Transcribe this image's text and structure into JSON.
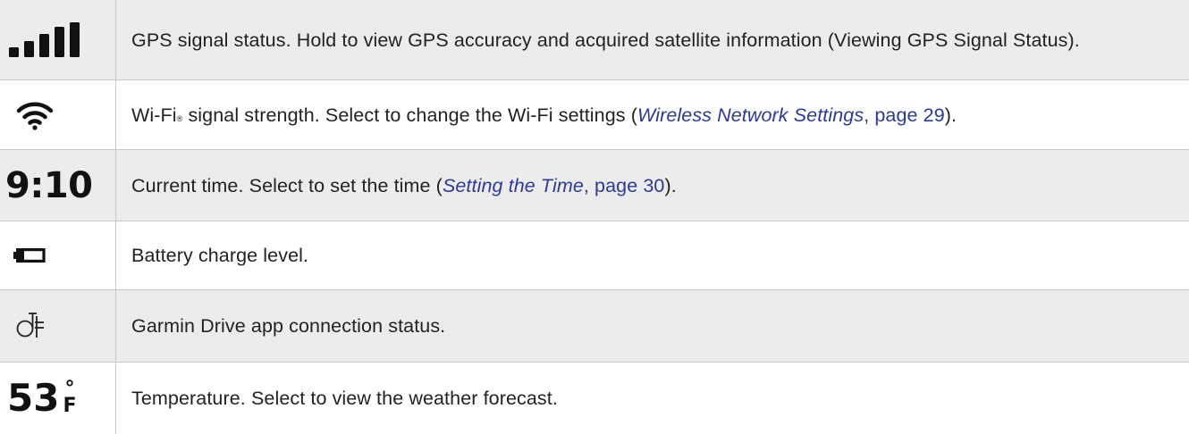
{
  "rows": [
    {
      "icon": "gps-signal-bars-icon",
      "text": "GPS signal status. Hold to view GPS accuracy and acquired satellite information (Viewing GPS Signal Status)."
    },
    {
      "icon": "wifi-icon",
      "text_before": "Wi-Fi",
      "registered": "®",
      "text_middle": " signal strength. Select to change the Wi-Fi settings (",
      "link_title": "Wireless Network Settings",
      "link_page": ", page 29",
      "text_after": ")."
    },
    {
      "icon": "clock-time-display",
      "icon_text": "9:10",
      "text_before": "Current time. Select to set the time (",
      "link_title": "Setting the Time",
      "link_page": ", page 30",
      "text_after": ")."
    },
    {
      "icon": "battery-icon",
      "text": "Battery charge level."
    },
    {
      "icon": "garmin-drive-connection-icon",
      "text": "Garmin Drive app connection status."
    },
    {
      "icon": "temperature-display",
      "icon_number": "53",
      "icon_degree": "°",
      "icon_unit": "F",
      "text": "Temperature. Select to view the weather forecast."
    }
  ],
  "colors": {
    "shaded_row": "#ececec",
    "border": "#c9c9c9",
    "link": "#2a3a9a",
    "text": "#222222"
  }
}
